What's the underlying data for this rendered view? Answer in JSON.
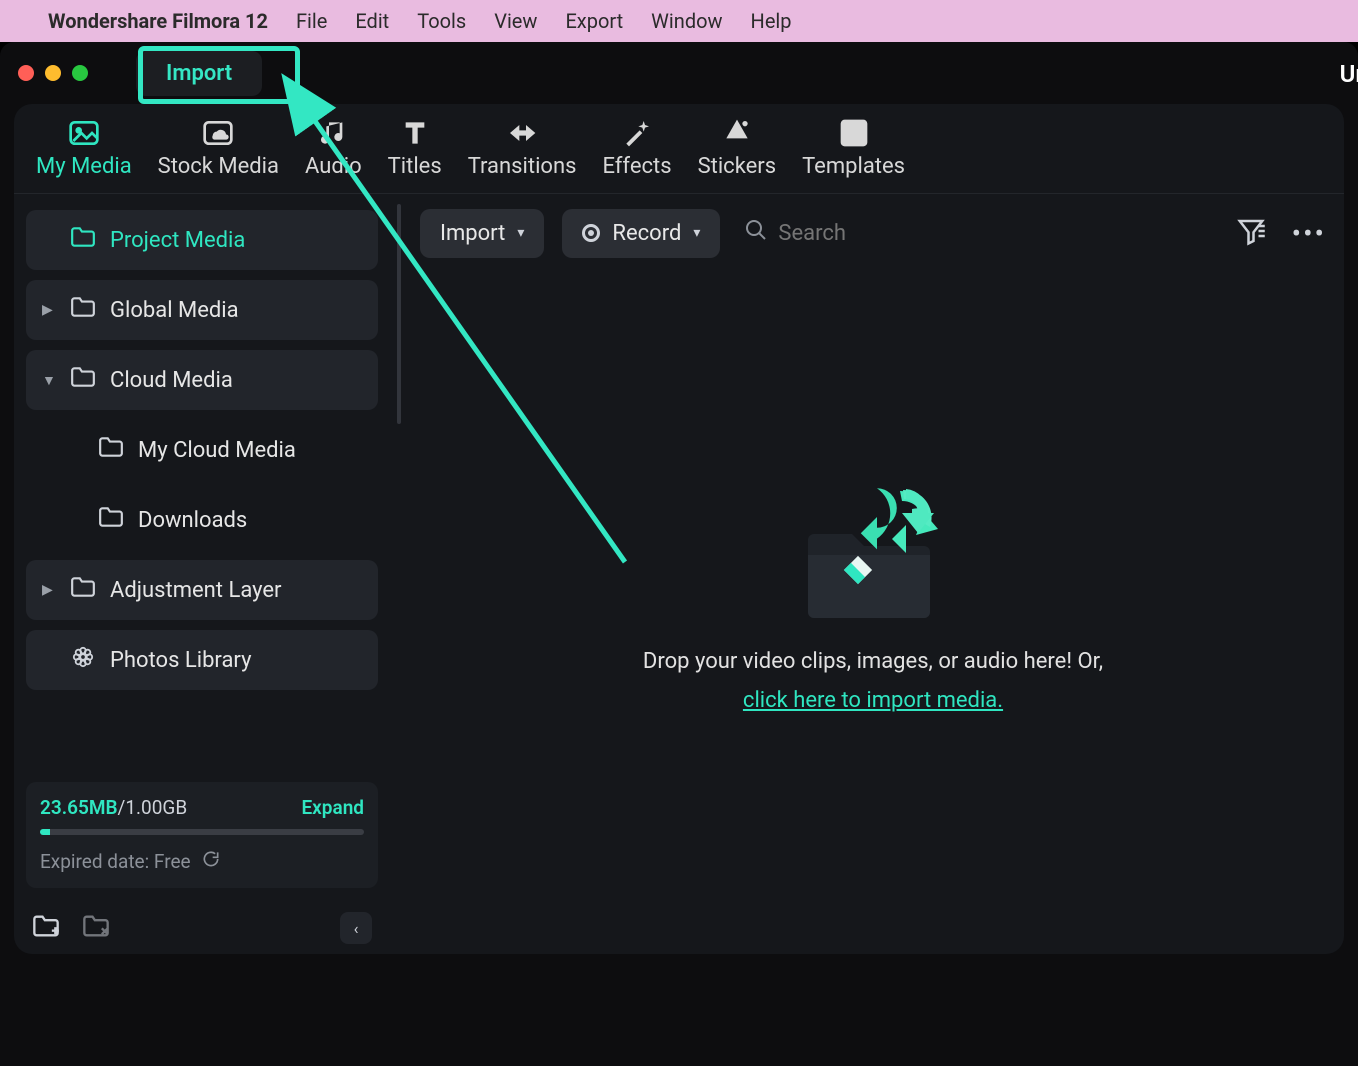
{
  "menubar": {
    "app_name": "Wondershare Filmora 12",
    "items": [
      "File",
      "Edit",
      "Tools",
      "View",
      "Export",
      "Window",
      "Help"
    ]
  },
  "titlebar": {
    "import_label": "Import",
    "right_text": "Ur"
  },
  "tabs": [
    {
      "label": "My Media"
    },
    {
      "label": "Stock Media"
    },
    {
      "label": "Audio"
    },
    {
      "label": "Titles"
    },
    {
      "label": "Transitions"
    },
    {
      "label": "Effects"
    },
    {
      "label": "Stickers"
    },
    {
      "label": "Templates"
    }
  ],
  "sidebar": {
    "project_media": "Project Media",
    "global_media": "Global Media",
    "cloud_media": "Cloud Media",
    "my_cloud_media": "My Cloud Media",
    "downloads": "Downloads",
    "adjustment_layer": "Adjustment Layer",
    "photos_library": "Photos Library"
  },
  "storage": {
    "used": "23.65MB",
    "sep": "/",
    "total": "1.00GB",
    "expand": "Expand",
    "expired": "Expired date: Free"
  },
  "toolbar": {
    "import_label": "Import",
    "record_label": "Record",
    "search_placeholder": "Search"
  },
  "drop": {
    "line1": "Drop your video clips, images, or audio here! Or,",
    "link": "click here to import media."
  }
}
